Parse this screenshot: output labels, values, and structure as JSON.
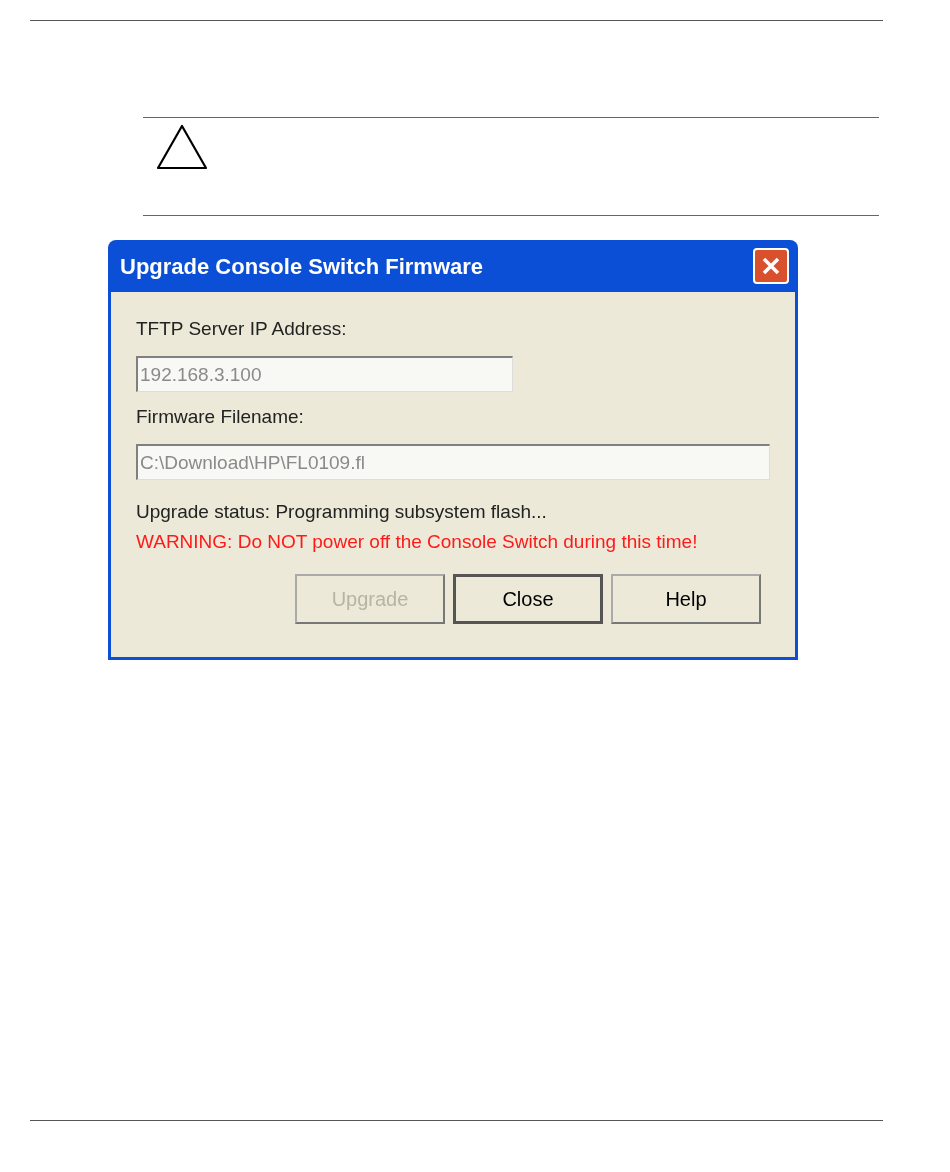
{
  "caution": {
    "kind": "caution"
  },
  "dialog": {
    "title": "Upgrade Console Switch Firmware",
    "fields": [
      {
        "label": "TFTP Server IP Address:",
        "value": "192.168.3.100",
        "disabled": true
      },
      {
        "label": "Firmware Filename:",
        "value": "C:\\Download\\HP\\FL0109.fl",
        "disabled": true
      }
    ],
    "status": "Upgrade status: Programming subsystem flash...",
    "warning": "WARNING: Do NOT power off the Console Switch during this time!",
    "buttons": [
      {
        "label": "Upgrade",
        "disabled": true,
        "default": false
      },
      {
        "label": "Close",
        "disabled": false,
        "default": true
      },
      {
        "label": "Help",
        "disabled": false,
        "default": false
      }
    ]
  }
}
